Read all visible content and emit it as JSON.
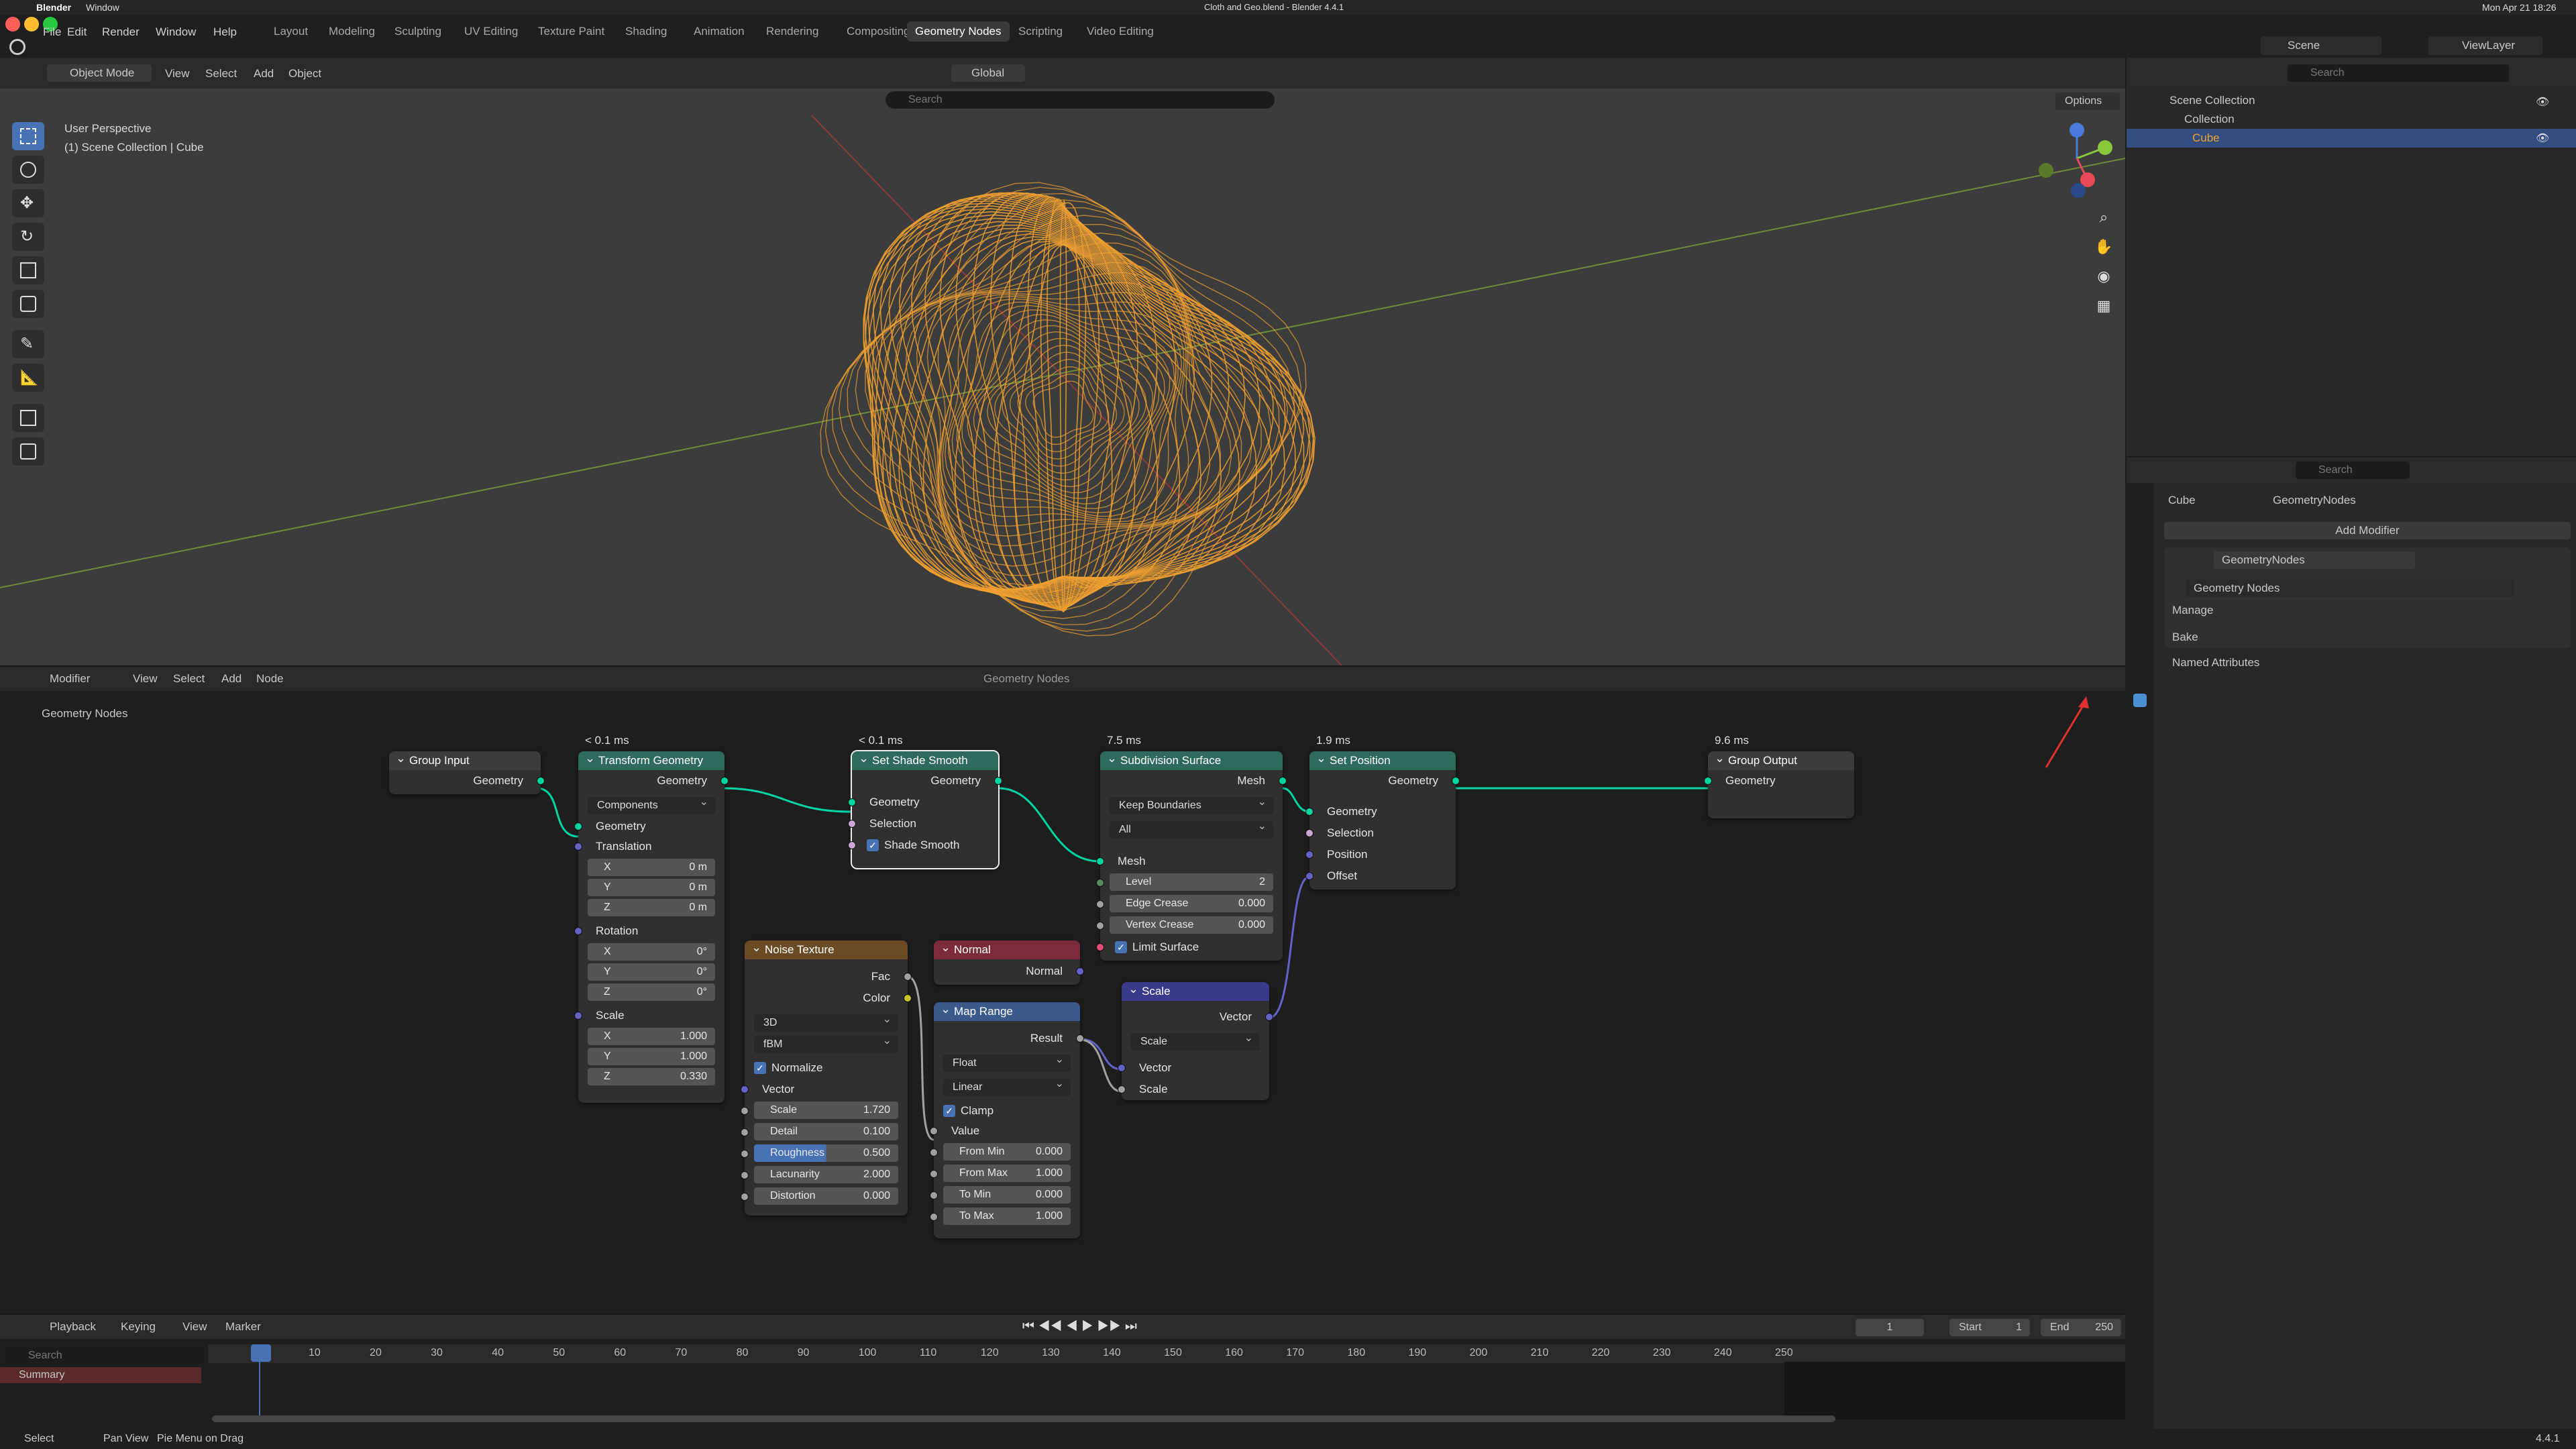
{
  "mac_menubar": {
    "app": "Blender",
    "window_menu": "Window",
    "title": "Cloth and Geo.blend - Blender 4.4.1",
    "clock": "Mon Apr 21 18:26"
  },
  "topbar": {
    "menus": [
      "File",
      "Edit",
      "Render",
      "Window",
      "Help"
    ],
    "workspaces": [
      "Layout",
      "Modeling",
      "Sculpting",
      "UV Editing",
      "Texture Paint",
      "Shading",
      "Animation",
      "Rendering",
      "Compositing",
      "Geometry Nodes",
      "Scripting",
      "Video Editing"
    ],
    "active_workspace": "Geometry Nodes",
    "scene": "Scene",
    "view_layer": "ViewLayer"
  },
  "viewport": {
    "mode": "Object Mode",
    "menus": [
      "View",
      "Select",
      "Add",
      "Object"
    ],
    "orientation": "Global",
    "search_placeholder": "Search",
    "options": "Options",
    "perspective": "User Perspective",
    "collection_path": "(1) Scene Collection | Cube",
    "mesh_color": "#f0a030"
  },
  "node_editor": {
    "editor_type": "Modifier",
    "menus": [
      "View",
      "Select",
      "Add",
      "Node"
    ],
    "tree_name": "Geometry Nodes",
    "breadcrumb": "Geometry Nodes",
    "nodes": {
      "group_input": {
        "title": "Group Input",
        "out": "Geometry"
      },
      "transform": {
        "timing": "< 0.1 ms",
        "title": "Transform Geometry",
        "out": "Geometry",
        "mode": "Components",
        "in_geo": "Geometry",
        "translation": "Translation",
        "rotation": "Rotation",
        "scale": "Scale",
        "tx": "0 m",
        "ty": "0 m",
        "tz": "0 m",
        "rx": "0°",
        "ry": "0°",
        "rz": "0°",
        "sx": "1.000",
        "sy": "1.000",
        "sz": "0.330",
        "x": "X",
        "y": "Y",
        "z": "Z"
      },
      "shade_smooth": {
        "timing": "< 0.1 ms",
        "title": "Set Shade Smooth",
        "out": "Geometry",
        "in_geo": "Geometry",
        "selection": "Selection",
        "shade": "Shade Smooth"
      },
      "subdivision": {
        "timing": "7.5 ms",
        "title": "Subdivision Surface",
        "out": "Mesh",
        "boundary": "Keep Boundaries",
        "uv": "All",
        "in_mesh": "Mesh",
        "level_label": "Level",
        "level": "2",
        "edge_label": "Edge Crease",
        "edge": "0.000",
        "vertex_label": "Vertex Crease",
        "vertex": "0.000",
        "limit": "Limit Surface"
      },
      "set_position": {
        "timing": "1.9 ms",
        "title": "Set Position",
        "out": "Geometry",
        "in_geo": "Geometry",
        "selection": "Selection",
        "position": "Position",
        "offset": "Offset"
      },
      "group_output": {
        "timing": "9.6 ms",
        "title": "Group Output",
        "in": "Geometry"
      },
      "noise": {
        "title": "Noise Texture",
        "fac": "Fac",
        "color": "Color",
        "dims": "3D",
        "type": "fBM",
        "normalize": "Normalize",
        "vector": "Vector",
        "scale_label": "Scale",
        "scale": "1.720",
        "detail_label": "Detail",
        "detail": "0.100",
        "rough_label": "Roughness",
        "rough": "0.500",
        "lac_label": "Lacunarity",
        "lac": "2.000",
        "dist_label": "Distortion",
        "dist": "0.000"
      },
      "normal": {
        "title": "Normal",
        "out": "Normal"
      },
      "map_range": {
        "title": "Map Range",
        "out": "Result",
        "dtype": "Float",
        "interp": "Linear",
        "clamp": "Clamp",
        "value": "Value",
        "fmin_label": "From Min",
        "fmin": "0.000",
        "fmax_label": "From Max",
        "fmax": "1.000",
        "tmin_label": "To Min",
        "tmin": "0.000",
        "tmax_label": "To Max",
        "tmax": "1.000"
      },
      "scale": {
        "title": "Scale",
        "out": "Vector",
        "op": "Scale",
        "vector": "Vector",
        "scale": "Scale"
      }
    }
  },
  "timeline": {
    "menus": [
      "Playback",
      "Keying",
      "View",
      "Marker"
    ],
    "current_frame": "1",
    "start_label": "Start",
    "start": "1",
    "end_label": "End",
    "end": "250",
    "search_placeholder": "Search",
    "summary": "Summary",
    "ticks": [
      "1",
      "10",
      "20",
      "30",
      "40",
      "50",
      "60",
      "70",
      "80",
      "90",
      "100",
      "110",
      "120",
      "130",
      "140",
      "150",
      "160",
      "170",
      "180",
      "190",
      "200",
      "210",
      "220",
      "230",
      "240",
      "250"
    ]
  },
  "outliner": {
    "search_placeholder": "Search",
    "items": [
      "Scene Collection",
      "Collection",
      "Cube"
    ]
  },
  "properties": {
    "search_placeholder": "Search",
    "breadcrumb": [
      "Cube",
      "GeometryNodes"
    ],
    "add_modifier": "Add Modifier",
    "modifier_name": "GeometryNodes",
    "node_group": "Geometry Nodes",
    "panels": [
      "Manage",
      "Bake",
      "Named Attributes"
    ]
  },
  "statusbar": {
    "items": [
      "Select",
      "Pan View",
      "Pie Menu on Drag"
    ],
    "version": "4.4.1"
  }
}
